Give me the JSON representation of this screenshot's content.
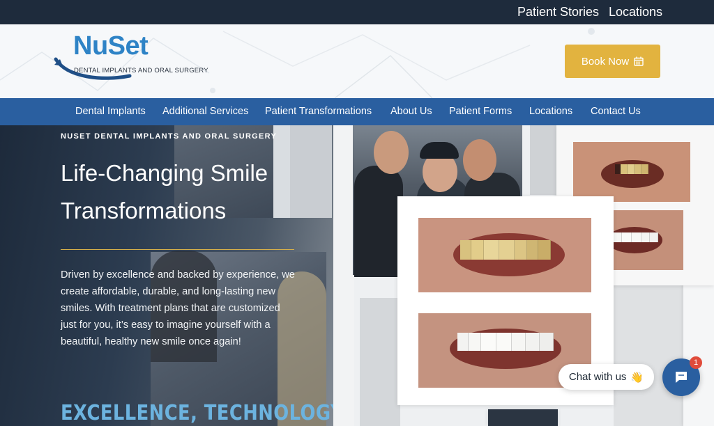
{
  "topbar": {
    "links": [
      "Patient Stories",
      "Locations"
    ]
  },
  "logo": {
    "name": "NuSet",
    "tagline": "DENTAL IMPLANTS AND ORAL SURGERY"
  },
  "header": {
    "book_label": "Book Now",
    "book_icon": "calendar-icon"
  },
  "nav": {
    "items": [
      "Dental Implants",
      "Additional Services",
      "Patient Transformations",
      "About Us",
      "Patient Forms",
      "Locations",
      "Contact Us"
    ]
  },
  "hero": {
    "eyebrow": "NUSET DENTAL IMPLANTS AND ORAL SURGERY",
    "title": "Life-Changing Smile Transformations",
    "body": "Driven by excellence and backed by experience, we create affordable, durable, and long-lasting new smiles. With treatment plans that are customized just for you, it’s easy to imagine yourself with a beautiful, healthy new smile once again!",
    "subheading": "EXCELLENCE, TECHNOLOGY"
  },
  "chat": {
    "label": "Chat with us",
    "emoji": "👋",
    "badge": "1"
  },
  "colors": {
    "topbar": "#1e2b3c",
    "nav": "#2a5fa0",
    "button": "#e2b33f",
    "accent_blue": "#2e83c6",
    "rule_gold": "#d7b04a"
  }
}
